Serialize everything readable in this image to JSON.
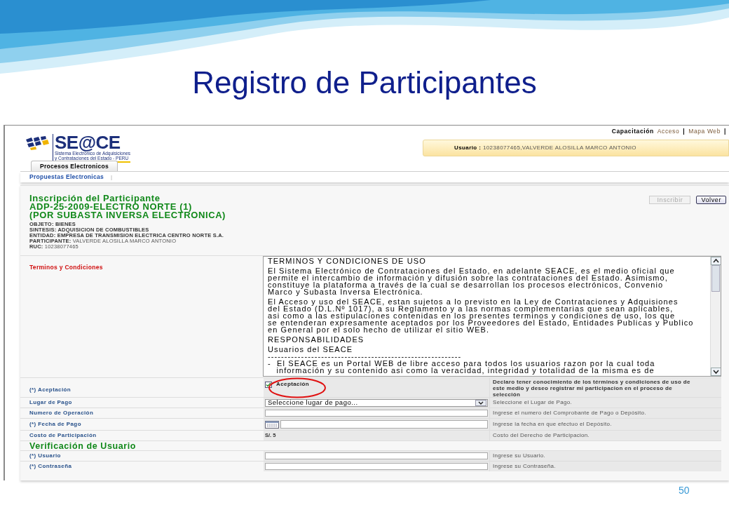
{
  "slide": {
    "title": "Registro de Participantes",
    "page_number": "50"
  },
  "logo": {
    "name": "SE@CE",
    "subtitle_lines": [
      "Sistema Electrónico de Adquisiciones",
      "y Contrataciones del Estado - PERU"
    ]
  },
  "top_links": [
    {
      "kind": "heading",
      "label": "Capacitación"
    },
    {
      "kind": "link",
      "label": "Acceso"
    },
    {
      "kind": "separator",
      "label": "|"
    },
    {
      "kind": "link",
      "label": "Mapa Web"
    },
    {
      "kind": "separator",
      "label": "|"
    }
  ],
  "user_bar": {
    "label": "Usuario :",
    "value": "10238077465,VALVERDE ALOSILLA MARCO ANTONIO"
  },
  "tabs": [
    {
      "label": "Procesos Electronicos",
      "selected": true
    }
  ],
  "subnav": [
    {
      "kind": "link",
      "label": "Propuestas Electronicas"
    },
    {
      "kind": "separator",
      "label": "|"
    }
  ],
  "heading_lines": [
    "Inscripción del Participante",
    "ADP-25-2009-ELECTRO NORTE (1)",
    "(POR SUBASTA INVERSA ELECTRONICA)"
  ],
  "details": [
    {
      "label": "OBJETO:",
      "value": "BIENES",
      "value_bold": true
    },
    {
      "label": "SINTESIS:",
      "value": "ADQUISICION DE COMBUSTIBLES",
      "value_bold": true
    },
    {
      "label": "ENTIDAD:",
      "value": "EMPRESA DE TRANSMISION ELECTRICA CENTRO NORTE S.A.",
      "value_bold": true
    },
    {
      "label": "PARTICIPANTE:",
      "value": "VALVERDE ALOSILLA MARCO ANTONIO",
      "value_bold": false
    },
    {
      "label": "RUC:",
      "value": "10238077465",
      "value_bold": false
    }
  ],
  "buttons": [
    {
      "label": "Inscribir",
      "disabled": true
    },
    {
      "label": "Volver",
      "disabled": false
    }
  ],
  "terms": {
    "label": "Terminos y Condiciones",
    "paragraphs": [
      [
        "TERMINOS Y CONDICIONES DE USO"
      ],
      [
        "El Sistema Electrónico de Contrataciones del Estado, en adelante SEACE, es el medio oficial que",
        "permite el intercambio de información y difusión sobre las contrataciones del Estado. Asimismo,",
        "constituye la plataforma a través de la cual se desarrollan los procesos electrónicos, Convenio",
        "Marco y Subasta Inversa Electrónica."
      ],
      [
        "El Acceso y uso del SEACE, estan sujetos a lo previsto en la Ley de Contrataciones y Adquisiones",
        "del Estado (D.L.Nº 1017), a su Reglamento y a las normas complementarias que sean aplicables,",
        "asi como a las estipulaciones contenidas en los presentes terminos y condiciones de uso, los que",
        "se entenderan expresamente aceptados por los Proveedores del Estado, Entidades Publicas y Publico",
        "en General por el solo hecho de utilizar el sitio WEB."
      ],
      [
        "RESPONSABILIDADES"
      ],
      [
        "Usuarios del SEACE",
        "----------------------------------------------------------",
        "-  El SEACE es un Portal WEB de libre acceso para todos los usuarios razon por la cual toda",
        "   información y su contenido asi como la veracidad, integridad y totalidad de la misma es de"
      ]
    ]
  },
  "form_rows": [
    {
      "kind": "checkbox",
      "label": "(*) Aceptación",
      "checkbox_label": "Aceptación",
      "checked": true,
      "help": "Declaro tener conocimiento de los términos y condiciones de uso de este medio y deseo registrar mi participacion en el proceso de selección"
    },
    {
      "kind": "select",
      "label": "Lugar de Pago",
      "value": "Seleccione lugar de pago...",
      "help": "Seleccione el Lugar de Pago."
    },
    {
      "kind": "input",
      "label": "Numero de Operación",
      "help": "Ingrese el numero del Comprobante de Pago o Depósito."
    },
    {
      "kind": "date",
      "label": "(*) Fecha de Pago",
      "help": "Ingrese la fecha en que efectuo el Depósito."
    },
    {
      "kind": "text",
      "label": "Costo de Participación",
      "value": "S/. 5",
      "help": "Costo del Derecho de Participacion."
    }
  ],
  "verification": {
    "title": "Verificación de Usuario",
    "rows": [
      {
        "label": "(*) Usuario",
        "help": "Ingrese su Usuario."
      },
      {
        "label": "(*) Contraseña",
        "help": "Ingrese su Contraseña."
      }
    ]
  }
}
